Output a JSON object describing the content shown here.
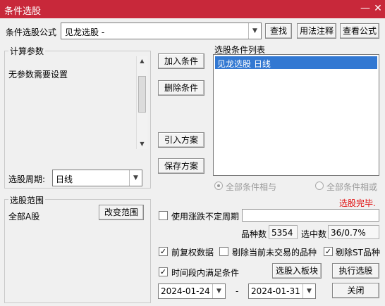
{
  "window": {
    "title": "条件选股",
    "minimize_label": "—",
    "close_label": "✕"
  },
  "formula": {
    "label": "条件选股公式",
    "value": "见龙选股      -",
    "find_button": "查找",
    "usage_button": "用法注释",
    "view_button": "查看公式"
  },
  "params": {
    "group_title": "计算参数",
    "text": "无参数需要设置",
    "period_label": "选股周期:",
    "period_value": "日线"
  },
  "actions": {
    "add_condition": "加入条件",
    "delete_condition": "删除条件",
    "import_scheme": "引入方案",
    "save_scheme": "保存方案"
  },
  "condition_list": {
    "title": "选股条件列表",
    "items": [
      "见龙选股  日线"
    ],
    "radio_and": "全部条件相与",
    "radio_or": "全部条件相或"
  },
  "status": {
    "text": "选股完毕.",
    "color": "#e01010"
  },
  "range": {
    "group_title": "选股范围",
    "value": "全部A股",
    "change_button": "改变范围"
  },
  "options": {
    "use_irregular_period": "使用涨跌不定周期",
    "variety_label": "品种数",
    "variety_value": "5354",
    "selected_label": "选中数",
    "selected_value": "36/0.7%",
    "prev_adjusted": "前复权数据",
    "exclude_untraded": "剔除当前未交易的品种",
    "exclude_st": "剔除ST品种",
    "time_period": "时间段内满足条件",
    "to_board_button": "选股入板块",
    "execute_button": "执行选股",
    "date_from": "2024-01-24",
    "date_sep": "-",
    "date_to": "2024-01-31",
    "close_button": "关闭"
  },
  "colors": {
    "title_bar": "#c8283a",
    "selection": "#3278d2"
  },
  "icons": {
    "checked": "check-mark",
    "dropdown": "chevron-down-icon"
  }
}
